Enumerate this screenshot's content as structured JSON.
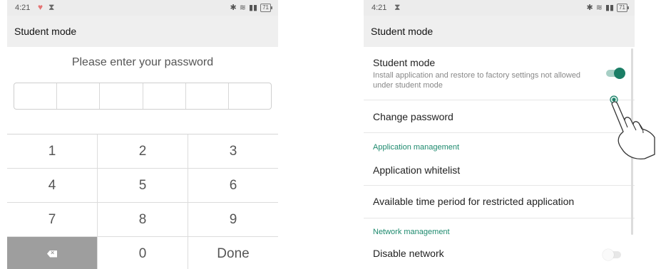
{
  "left": {
    "status": {
      "time": "4:21",
      "battery": "71"
    },
    "title": "Student mode",
    "prompt": "Please enter your password",
    "keypad": [
      [
        "1",
        "2",
        "3"
      ],
      [
        "4",
        "5",
        "6"
      ],
      [
        "7",
        "8",
        "9"
      ],
      [
        "",
        "0",
        "Done"
      ]
    ]
  },
  "right": {
    "status": {
      "time": "4:21",
      "battery": "71"
    },
    "title": "Student mode",
    "student_mode": {
      "title": "Student mode",
      "subtitle": "Install application and restore to factory settings not allowed under student mode",
      "enabled": true
    },
    "change_password": "Change password",
    "section_app": "Application management",
    "app_whitelist": "Application whitelist",
    "time_period": "Available time period for restricted application",
    "section_network": "Network management",
    "disable_network": {
      "label": "Disable network",
      "enabled": false
    },
    "colors": {
      "accent": "#1b7e66",
      "section": "#1e8a6e"
    }
  }
}
